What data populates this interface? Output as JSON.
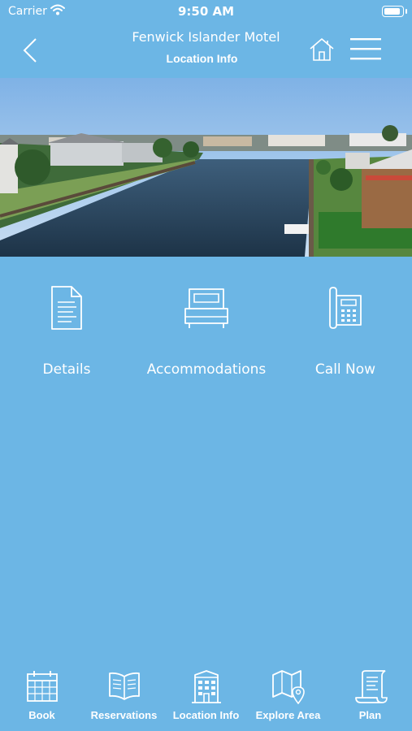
{
  "status_bar": {
    "carrier": "Carrier",
    "time": "9:50 AM",
    "battery_level": 0.9
  },
  "header": {
    "title": "Fenwick Islander Motel",
    "subtitle": "Location Info"
  },
  "actions": [
    {
      "label": "Details",
      "icon": "document-icon"
    },
    {
      "label": "Accommodations",
      "icon": "bed-icon"
    },
    {
      "label": "Call Now",
      "icon": "phone-icon"
    }
  ],
  "tab_bar": {
    "items": [
      {
        "label": "Book",
        "icon": "calendar-icon"
      },
      {
        "label": "Reservations",
        "icon": "book-icon"
      },
      {
        "label": "Location Info",
        "icon": "building-icon"
      },
      {
        "label": "Explore Area",
        "icon": "map-icon"
      },
      {
        "label": "Plan",
        "icon": "scroll-icon"
      }
    ]
  },
  "colors": {
    "background": "#6cb6e5",
    "foreground": "#ffffff"
  }
}
